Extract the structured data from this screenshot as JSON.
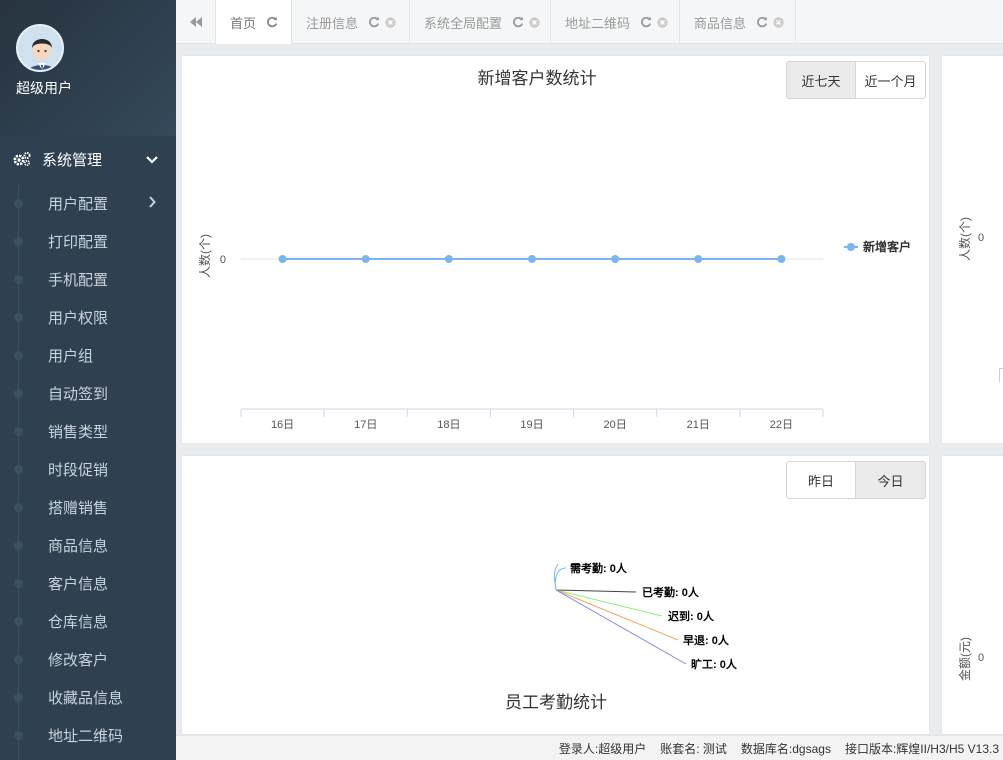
{
  "sidebar": {
    "user_name": "超级用户",
    "group_label": "系统管理",
    "items": [
      {
        "label": "用户配置"
      },
      {
        "label": "打印配置"
      },
      {
        "label": "手机配置"
      },
      {
        "label": "用户权限"
      },
      {
        "label": "用户组"
      },
      {
        "label": "自动签到"
      },
      {
        "label": "销售类型"
      },
      {
        "label": "时段促销"
      },
      {
        "label": "搭赠销售"
      },
      {
        "label": "商品信息"
      },
      {
        "label": "客户信息"
      },
      {
        "label": "仓库信息"
      },
      {
        "label": "修改客户"
      },
      {
        "label": "收藏品信息"
      },
      {
        "label": "地址二维码"
      }
    ]
  },
  "tabs": [
    {
      "label": "首页"
    },
    {
      "label": "注册信息"
    },
    {
      "label": "系统全局配置"
    },
    {
      "label": "地址二维码"
    },
    {
      "label": "商品信息"
    }
  ],
  "customer_chart": {
    "buttons": [
      "近七天",
      "近一个月"
    ]
  },
  "attendance_chart": {
    "buttons": [
      "昨日",
      "今日"
    ]
  },
  "right_panels": {
    "top_ylabel": "人数(个)",
    "top_tick": "0",
    "bottom_ylabel": "金额(元)",
    "bottom_tick": "0"
  },
  "status": {
    "login": "登录人:超级用户",
    "account": "账套名: 测试",
    "database": "数据库名:dgsags",
    "version": "接口版本:辉煌II/H3/H5 V13.3"
  },
  "chart_data": [
    {
      "type": "line",
      "title": "新增客户数统计",
      "ylabel": "人数(个)",
      "xlabel": "",
      "categories": [
        "16日",
        "17日",
        "18日",
        "19日",
        "20日",
        "21日",
        "22日"
      ],
      "yticks": [
        "0"
      ],
      "series": [
        {
          "name": "新增客户",
          "values": [
            0,
            0,
            0,
            0,
            0,
            0,
            0
          ],
          "color": "#7cb5ec"
        }
      ],
      "legend": "right"
    },
    {
      "type": "pie",
      "title": "员工考勤统计",
      "slices": [
        {
          "label": "需考勤",
          "value": 0,
          "unit": "人",
          "color": "#7cb5ec"
        },
        {
          "label": "已考勤",
          "value": 0,
          "unit": "人",
          "color": "#434348"
        },
        {
          "label": "迟到",
          "value": 0,
          "unit": "人",
          "color": "#90ed7d"
        },
        {
          "label": "早退",
          "value": 0,
          "unit": "人",
          "color": "#f7a35c"
        },
        {
          "label": "旷工",
          "value": 0,
          "unit": "人",
          "color": "#8085e9"
        }
      ]
    }
  ]
}
